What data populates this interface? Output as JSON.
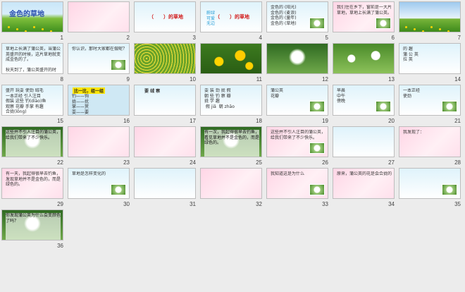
{
  "slides": [
    {
      "num": "1",
      "title": "金色的草地",
      "text": ""
    },
    {
      "num": "2",
      "title": "",
      "text": ""
    },
    {
      "num": "3",
      "title": "（　　）的草地",
      "text": ""
    },
    {
      "num": "4",
      "title": "（　　）的草地",
      "text": "蔚绿\n可爱\n无边"
    },
    {
      "num": "5",
      "title": "",
      "text": "金色的 (阳光)\n金色的 (麦浪)\n金色的 (童年)\n金色的 (草地)"
    },
    {
      "num": "6",
      "title": "",
      "text": "我们住在乡下，窗前是一大片草地，草地上长满了蒲公英。"
    },
    {
      "num": "7",
      "title": "",
      "text": ""
    },
    {
      "num": "8",
      "title": "",
      "text": "草地上长满了蒲公英，当蒲公英盛开的时候，这片草地就变成金色的了。\n\n秋天到了，蒲公英盛开的时候。"
    },
    {
      "num": "9",
      "title": "",
      "text": "你认识，那时大家都在做呢？"
    },
    {
      "num": "10",
      "title": "",
      "text": ""
    },
    {
      "num": "11",
      "title": "",
      "text": ""
    },
    {
      "num": "12",
      "title": "",
      "text": ""
    },
    {
      "num": "13",
      "title": "",
      "text": ""
    },
    {
      "num": "14",
      "title": "",
      "text": "的 趣\n蒲 公 英\n拉 英"
    },
    {
      "num": "15",
      "title": "",
      "text": "盛开 玩耍 使劲 绒毛\n一本正经 引人注目\n假装 这些 钓(diào)鱼\n观察 花瓣 手掌 有趣\n合拢(lǒng)"
    },
    {
      "num": "16",
      "title": "比一比，组一组",
      "text": "钓——钩\n拢——扰\n掌——赏\n耍——要"
    },
    {
      "num": "17",
      "title": "要 绒 察",
      "text": ""
    },
    {
      "num": "18",
      "title": "",
      "text": "耍 装 劲 拢 假\n朝 些 钓 察 瓣\n拢 学 趣\n 假 jiǎ  朝 zhāo"
    },
    {
      "num": "19",
      "title": "",
      "text": "蒲公英\n花瓣"
    },
    {
      "num": "20",
      "title": "",
      "text": "早晨\n中午\n傍晚"
    },
    {
      "num": "21",
      "title": "",
      "text": "一本正经\n使劲"
    },
    {
      "num": "22",
      "title": "",
      "text": "这些并不引人注目的蒲公英，给我们带来了不少快乐。"
    },
    {
      "num": "23",
      "title": "",
      "text": ""
    },
    {
      "num": "24",
      "title": "",
      "text": ""
    },
    {
      "num": "25",
      "title": "",
      "text": "有一次，我起得很早去钓鱼，看见草地并不是金色的，而是绿色的。"
    },
    {
      "num": "26",
      "title": "",
      "text": "这些并不引人注目的蒲公英，给我们带来了不少快乐。"
    },
    {
      "num": "27",
      "title": "",
      "text": ""
    },
    {
      "num": "28",
      "title": "",
      "text": "我发现了："
    },
    {
      "num": "29",
      "title": "",
      "text": "有一天，我起得很早去钓鱼，发现草地并不是金色的，而是绿色的。"
    },
    {
      "num": "30",
      "title": "",
      "text": "草地是怎样变化的"
    },
    {
      "num": "31",
      "title": "",
      "text": ""
    },
    {
      "num": "32",
      "title": "",
      "text": ""
    },
    {
      "num": "33",
      "title": "",
      "text": "我知道这是为什么"
    },
    {
      "num": "34",
      "title": "",
      "text": "原来，蒲公英的花是会合拢的"
    },
    {
      "num": "35",
      "title": "",
      "text": ""
    },
    {
      "num": "36",
      "title": "",
      "text": "你发现蒲公英为什么会变颜色了吗？"
    }
  ],
  "colors": {
    "accent": "#d11a1a",
    "sky": "#9ec9ee",
    "grass": "#3f8f1e",
    "flower": "#ffd400",
    "pink": "#ffd6e6"
  }
}
